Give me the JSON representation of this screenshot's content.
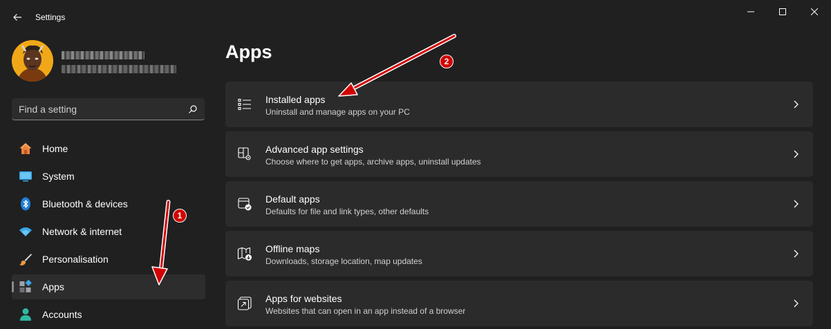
{
  "window": {
    "title": "Settings"
  },
  "profile": {
    "name_redacted": true,
    "email_redacted": true
  },
  "search": {
    "placeholder": "Find a setting"
  },
  "sidebar": {
    "items": [
      {
        "label": "Home",
        "icon": "home-icon",
        "selected": false
      },
      {
        "label": "System",
        "icon": "system-icon",
        "selected": false
      },
      {
        "label": "Bluetooth & devices",
        "icon": "bluetooth-icon",
        "selected": false
      },
      {
        "label": "Network & internet",
        "icon": "wifi-icon",
        "selected": false
      },
      {
        "label": "Personalisation",
        "icon": "brush-icon",
        "selected": false
      },
      {
        "label": "Apps",
        "icon": "apps-icon",
        "selected": true
      },
      {
        "label": "Accounts",
        "icon": "accounts-icon",
        "selected": false
      }
    ]
  },
  "main": {
    "title": "Apps",
    "cards": [
      {
        "title": "Installed apps",
        "subtitle": "Uninstall and manage apps on your PC",
        "icon": "list-icon"
      },
      {
        "title": "Advanced app settings",
        "subtitle": "Choose where to get apps, archive apps, uninstall updates",
        "icon": "app-settings-icon"
      },
      {
        "title": "Default apps",
        "subtitle": "Defaults for file and link types, other defaults",
        "icon": "default-apps-icon"
      },
      {
        "title": "Offline maps",
        "subtitle": "Downloads, storage location, map updates",
        "icon": "map-download-icon"
      },
      {
        "title": "Apps for websites",
        "subtitle": "Websites that can open in an app instead of a browser",
        "icon": "open-in-app-icon"
      }
    ]
  },
  "annotations": {
    "badge1": "1",
    "badge2": "2",
    "color": "#d10000"
  },
  "colors": {
    "background": "#202020",
    "card": "#2b2b2b",
    "selected": "#2d2d2d"
  }
}
